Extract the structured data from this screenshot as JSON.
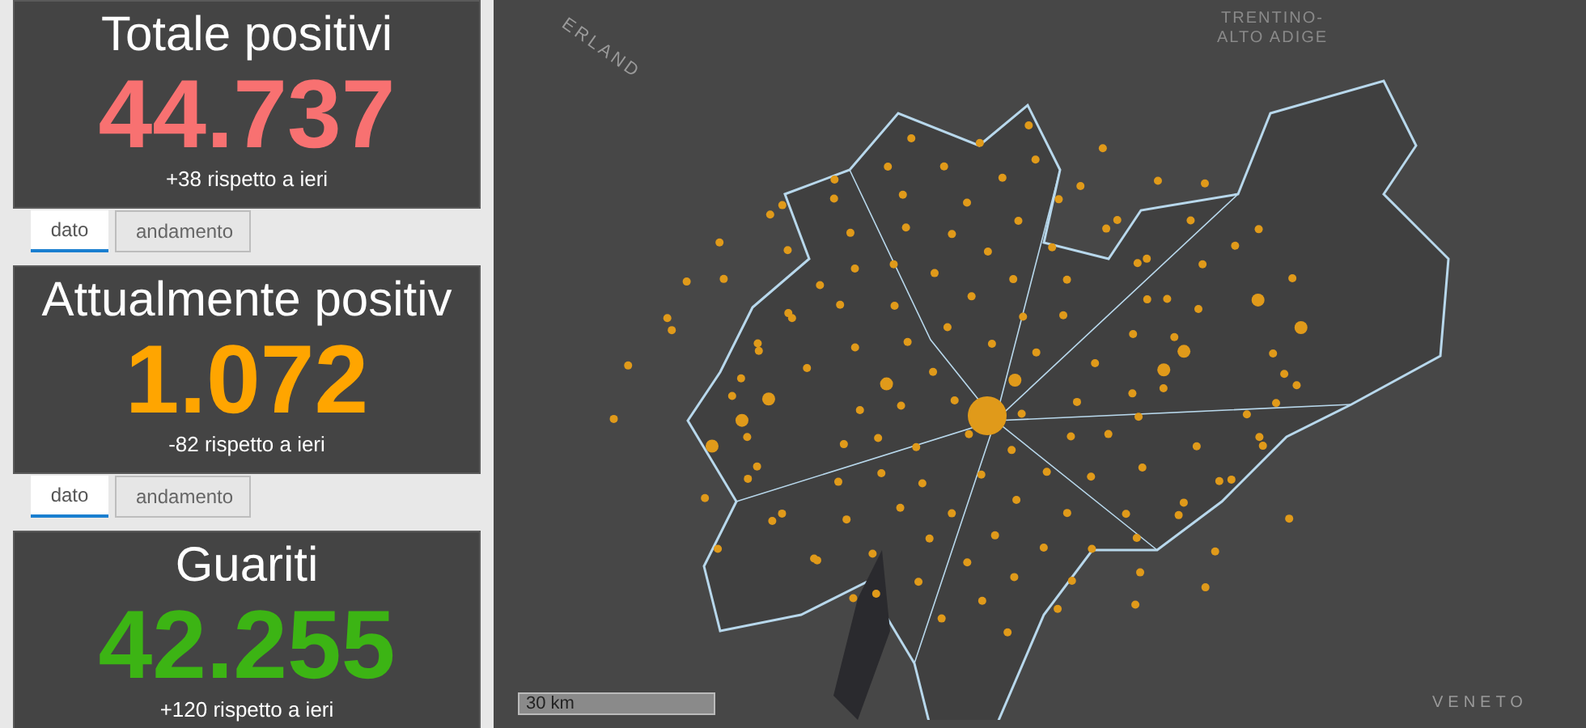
{
  "cards": [
    {
      "title": "Totale positivi",
      "value": "44.737",
      "delta": "+38 rispetto a ieri",
      "color": "#f87171",
      "tabs": [
        {
          "label": "dato",
          "selected": true
        },
        {
          "label": "andamento",
          "selected": false
        }
      ]
    },
    {
      "title": "Attualmente positiv",
      "value": "1.072",
      "delta": "-82 rispetto a ieri",
      "color": "#ffa500",
      "tabs": [
        {
          "label": "dato",
          "selected": true
        },
        {
          "label": "andamento",
          "selected": false
        }
      ]
    },
    {
      "title": "Guariti",
      "value": "42.255",
      "delta": "+120 rispetto a ieri",
      "color": "#3cb414"
    }
  ],
  "map": {
    "labels": [
      "ERLAND",
      "TRENTINO-\nALTO ADIGE",
      "VENETO"
    ],
    "scale": "30 km"
  }
}
